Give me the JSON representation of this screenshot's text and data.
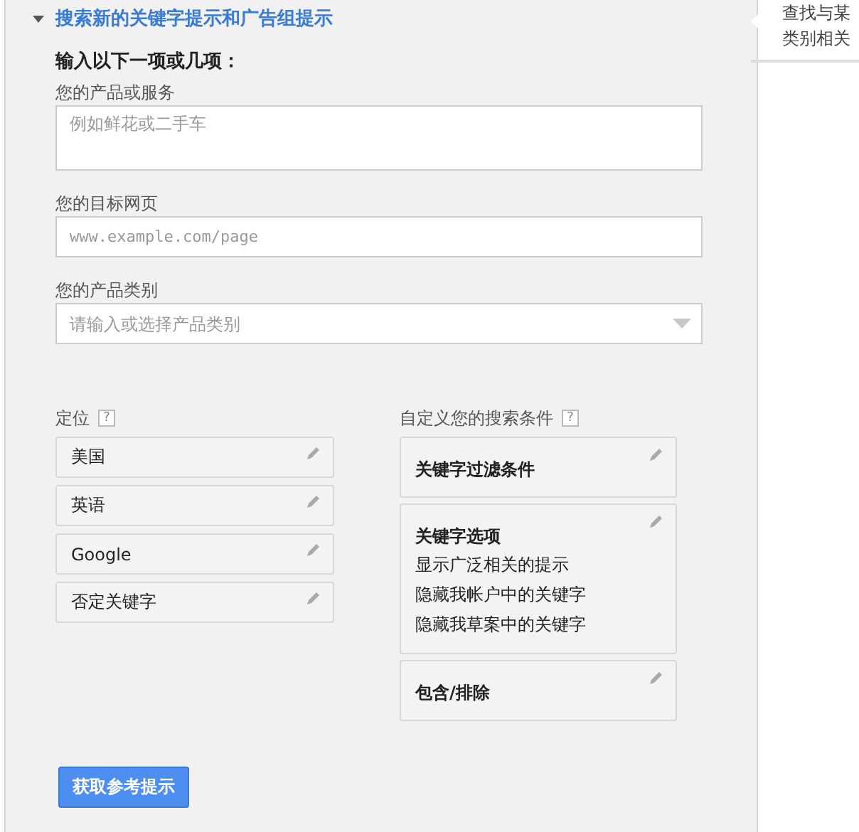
{
  "section": {
    "title": "搜索新的关键字提示和广告组提示",
    "expanded": true
  },
  "form": {
    "heading": "输入以下一项或几项：",
    "fields": [
      {
        "label": "您的产品或服务",
        "kind": "textarea",
        "placeholder": "例如鲜花或二手车"
      },
      {
        "label": "您的目标网页",
        "kind": "text",
        "placeholder": "www.example.com/page"
      },
      {
        "label": "您的产品类别",
        "kind": "dropdown",
        "placeholder": "请输入或选择产品类别"
      }
    ]
  },
  "targeting": {
    "title": "定位",
    "help": "?",
    "items": [
      "美国",
      "英语",
      "Google",
      "否定关键字"
    ]
  },
  "criteria": {
    "title": "自定义您的搜索条件",
    "help": "?",
    "cards": [
      {
        "title": "关键字过滤条件"
      },
      {
        "title": "关键字选项",
        "lines": [
          "显示广泛相关的提示",
          "隐藏我帐户中的关键字",
          "隐藏我草案中的关键字"
        ]
      },
      {
        "title": "包含/排除"
      }
    ]
  },
  "button": "获取参考提示",
  "tooltip": {
    "lines": [
      "查找与某",
      "类别相关"
    ]
  }
}
